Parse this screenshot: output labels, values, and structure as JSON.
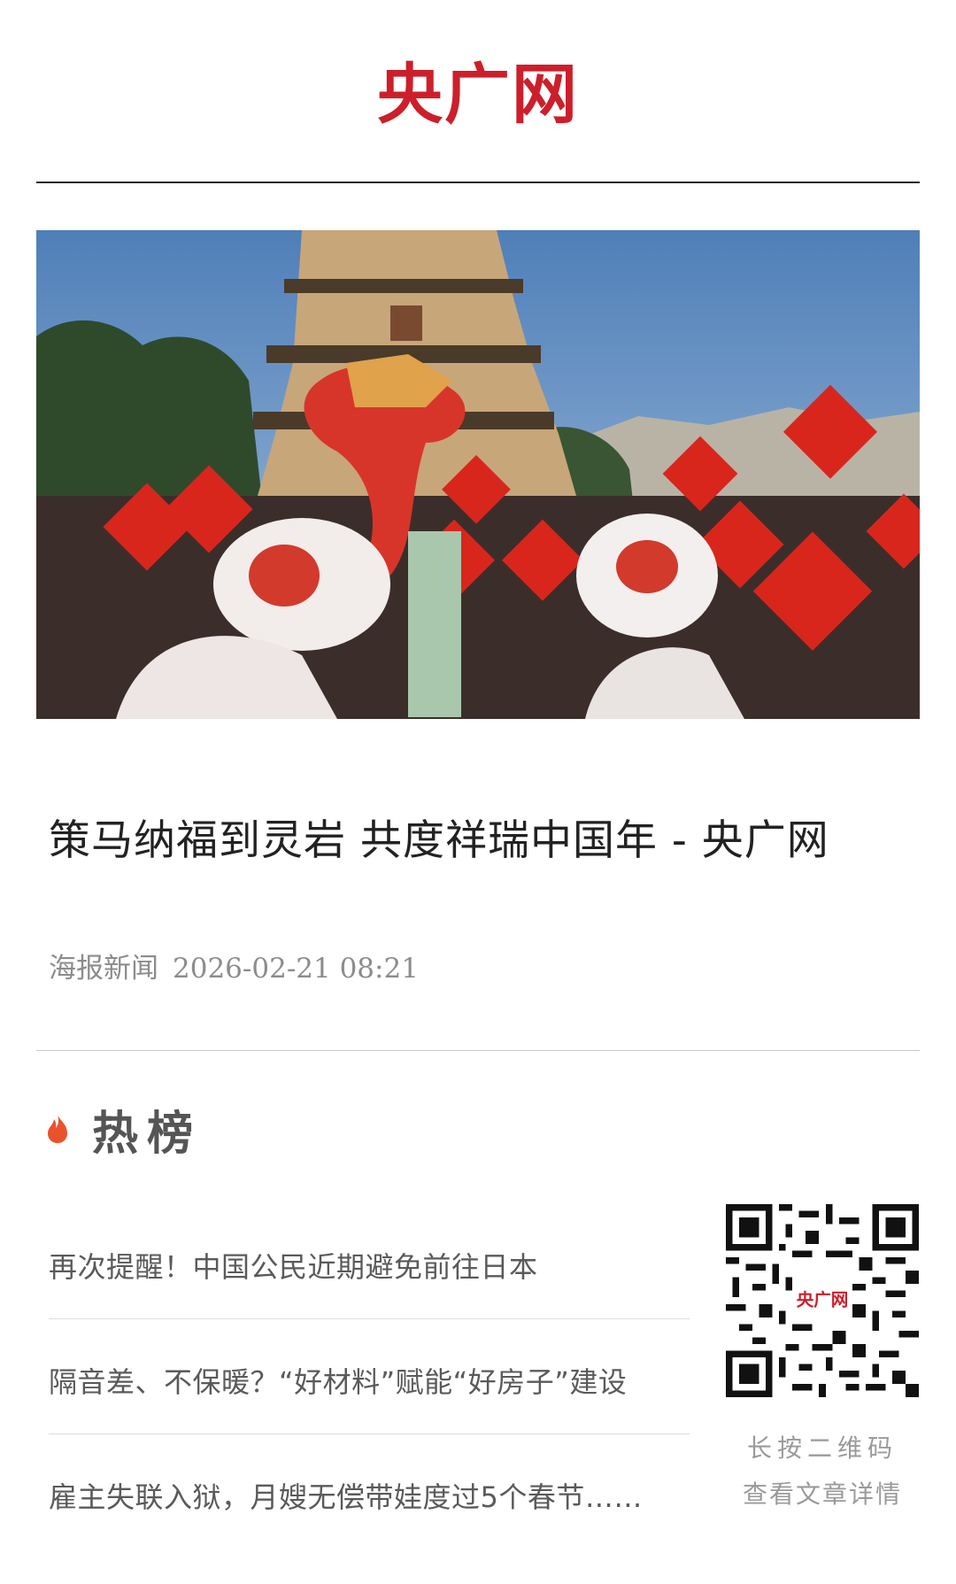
{
  "header": {
    "logo_text": "央广网"
  },
  "article": {
    "title": "策马纳福到灵岩 共度祥瑞中国年 - 央广网",
    "source": "海报新闻",
    "datetime": "2026-02-21 08:21",
    "image_alt": "灵岩寺辟支塔前舞龙舞狮，游客手举福字"
  },
  "hot": {
    "title": "热榜",
    "items": [
      {
        "title": "再次提醒！中国公民近期避免前往日本"
      },
      {
        "title": "隔音差、不保暖？“好材料”赋能“好房子”建设"
      },
      {
        "title": "雇主失联入狱，月嫂无偿带娃度过5个春节……"
      }
    ]
  },
  "qr": {
    "center_text": "央广网",
    "caption_line1": "长按二维码",
    "caption_line2": "查看文章详情"
  },
  "colors": {
    "brand_red": "#cc1f2b",
    "flame": "#e8532d"
  },
  "icons": {
    "hot_icon": "flame-icon"
  }
}
